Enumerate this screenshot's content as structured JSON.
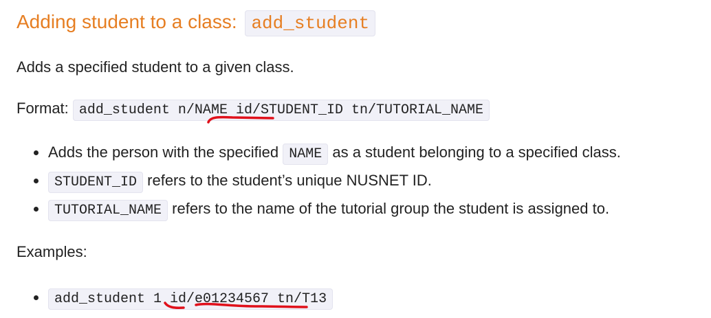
{
  "heading": {
    "text": "Adding student to a class: ",
    "command": "add_student"
  },
  "description": "Adds a specified student to a given class.",
  "format": {
    "label": "Format: ",
    "command": "add_student n/NAME id/STUDENT_ID tn/TUTORIAL_NAME"
  },
  "bullets": [
    {
      "before": "Adds the person with the specified ",
      "code": "NAME",
      "after": " as a student belonging to a specified class."
    },
    {
      "before": "",
      "code": "STUDENT_ID",
      "after": " refers to the student’s unique NUSNET ID."
    },
    {
      "before": "",
      "code": "TUTORIAL_NAME",
      "after": " refers to the name of the tutorial group the student is assigned to."
    }
  ],
  "examples_label": "Examples:",
  "examples": [
    {
      "code": "add_student 1 id/e01234567 tn/T13"
    }
  ],
  "colors": {
    "heading": "#e67e22",
    "code_background": "#f1f1f8",
    "annotation": "#e0101a"
  }
}
